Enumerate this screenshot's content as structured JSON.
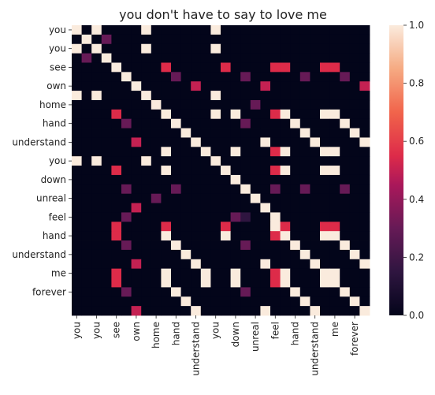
{
  "chart_data": {
    "type": "heatmap",
    "title": "you don't have to say to love me",
    "xlabel": "",
    "ylabel": "",
    "row_tick_labels": [
      "you",
      "you",
      "see",
      "own",
      "home",
      "hand",
      "understand",
      "you",
      "down",
      "unreal",
      "feel",
      "hand",
      "understand",
      "me",
      "forever"
    ],
    "col_tick_labels": [
      "you",
      "you",
      "see",
      "own",
      "home",
      "hand",
      "understand",
      "you",
      "down",
      "unreal",
      "feel",
      "hand",
      "understand",
      "me",
      "forever"
    ],
    "colorbar": {
      "min": 0.0,
      "max": 1.0,
      "ticks": [
        "0.0",
        "0.2",
        "0.4",
        "0.6",
        "0.8",
        "1.0"
      ]
    },
    "grid": false,
    "values": [
      [
        1,
        0,
        1,
        0,
        0,
        0,
        0,
        1,
        0,
        0,
        0,
        0,
        0,
        0,
        1,
        0,
        0,
        0,
        0,
        0,
        0,
        0,
        0,
        0,
        0,
        0,
        0,
        0,
        0,
        0
      ],
      [
        0,
        1,
        0,
        0.3,
        0,
        0,
        0,
        0,
        0,
        0,
        0,
        0,
        0,
        0,
        0,
        0,
        0,
        0,
        0,
        0,
        0,
        0,
        0,
        0,
        0,
        0,
        0,
        0,
        0,
        0
      ],
      [
        1,
        0,
        1,
        0,
        0,
        0,
        0,
        1,
        0,
        0,
        0,
        0,
        0,
        0,
        1,
        0,
        0,
        0,
        0,
        0,
        0,
        0,
        0,
        0,
        0,
        0,
        0,
        0,
        0,
        0
      ],
      [
        0,
        0.3,
        0,
        1,
        0,
        0,
        0,
        0,
        0,
        0,
        0,
        0,
        0,
        0,
        0,
        0,
        0,
        0,
        0,
        0,
        0,
        0,
        0,
        0,
        0,
        0,
        0,
        0,
        0,
        0
      ],
      [
        0,
        0,
        0,
        0,
        1,
        0,
        0,
        0,
        0,
        0.55,
        0,
        0,
        0,
        0,
        0,
        0.55,
        0,
        0,
        0,
        0,
        0.55,
        0.55,
        0,
        0,
        0,
        0.55,
        0.55,
        0,
        0,
        0
      ],
      [
        0,
        0,
        0,
        0,
        0,
        1,
        0,
        0,
        0,
        0,
        0.3,
        0,
        0,
        0,
        0,
        0,
        0,
        0.3,
        0,
        0,
        0,
        0,
        0,
        0.3,
        0,
        0,
        0,
        0.3,
        0,
        0
      ],
      [
        0,
        0,
        0,
        0,
        0,
        0,
        1,
        0,
        0,
        0,
        0,
        0,
        0.5,
        0,
        0,
        0,
        0,
        0,
        0,
        0.5,
        0,
        0,
        0,
        0,
        0,
        0,
        0,
        0,
        0,
        0.5
      ],
      [
        1,
        0,
        1,
        0,
        0,
        0,
        0,
        1,
        0,
        0,
        0,
        0,
        0,
        0,
        1,
        0,
        0,
        0,
        0,
        0,
        0,
        0,
        0,
        0,
        0,
        0,
        0,
        0,
        0,
        0
      ],
      [
        0,
        0,
        0,
        0,
        0,
        0,
        0,
        0,
        1,
        0,
        0,
        0,
        0,
        0,
        0,
        0,
        0,
        0,
        0.3,
        0,
        0,
        0,
        0,
        0,
        0,
        0,
        0,
        0,
        0,
        0
      ],
      [
        0,
        0,
        0,
        0,
        0.55,
        0,
        0,
        0,
        0,
        1,
        0,
        0,
        0,
        0,
        1,
        0,
        1,
        0,
        0,
        0,
        0.55,
        1,
        0,
        0,
        0,
        1,
        1,
        0,
        0,
        0
      ],
      [
        0,
        0,
        0,
        0,
        0,
        0.3,
        0,
        0,
        0,
        0,
        1,
        0,
        0,
        0,
        0,
        0,
        0,
        0.3,
        0,
        0,
        0,
        0,
        1,
        0,
        0,
        0,
        0,
        1,
        0,
        0
      ],
      [
        0,
        0,
        0,
        0,
        0,
        0,
        0,
        0,
        0,
        0,
        0,
        1,
        0,
        0,
        0,
        0,
        0,
        0,
        0,
        0,
        0,
        0,
        0,
        1,
        0,
        0,
        0,
        0,
        1,
        0
      ],
      [
        0,
        0,
        0,
        0,
        0,
        0,
        0.5,
        0,
        0,
        0,
        0,
        0,
        1,
        0,
        0,
        0,
        0,
        0,
        0,
        1,
        0,
        0,
        0,
        0,
        1,
        0,
        0,
        0,
        0,
        1
      ],
      [
        0,
        0,
        0,
        0,
        0,
        0,
        0,
        0,
        0,
        1,
        0,
        0,
        0,
        1,
        0,
        0,
        1,
        0,
        0,
        0,
        0.55,
        1,
        0,
        0,
        0,
        1,
        1,
        0,
        0,
        0
      ],
      [
        1,
        0,
        1,
        0,
        0,
        0,
        0,
        1,
        0,
        0,
        0,
        0,
        0,
        0,
        1,
        0,
        0,
        0,
        0,
        0,
        0,
        0,
        0,
        0,
        0,
        0,
        0,
        0,
        0,
        0
      ],
      [
        0,
        0,
        0,
        0,
        0.55,
        0,
        0,
        0,
        0,
        1,
        0,
        0,
        0,
        0,
        0,
        1,
        0,
        0,
        0,
        0,
        0.55,
        1,
        0,
        0,
        0,
        1,
        1,
        0,
        0,
        0
      ],
      [
        0,
        0,
        0,
        0,
        0,
        0,
        0,
        0,
        0,
        0,
        0,
        0,
        0,
        0,
        0,
        0,
        1,
        0,
        0,
        0,
        0,
        0,
        0,
        0,
        0,
        0,
        0,
        0,
        0,
        0
      ],
      [
        0,
        0,
        0,
        0,
        0,
        0.3,
        0,
        0,
        0,
        0,
        0.3,
        0,
        0,
        0,
        0,
        0,
        0,
        1,
        0,
        0,
        0.3,
        0,
        0,
        0.3,
        0,
        0,
        0,
        0.3,
        0,
        0
      ],
      [
        0,
        0,
        0,
        0,
        0,
        0,
        0,
        0,
        0.3,
        0,
        0,
        0,
        0,
        0,
        0,
        0,
        0,
        0,
        1,
        0,
        0,
        0,
        0,
        0,
        0,
        0,
        0,
        0,
        0,
        0
      ],
      [
        0,
        0,
        0,
        0,
        0,
        0,
        0.5,
        0,
        0,
        0,
        0,
        0,
        0,
        0,
        0,
        0,
        0,
        0,
        0,
        1,
        0,
        0,
        0,
        0,
        0,
        0,
        0,
        0,
        0,
        0
      ],
      [
        0,
        0,
        0,
        0,
        0,
        0.3,
        0,
        0,
        0,
        0,
        0,
        0,
        0,
        0,
        0,
        0,
        0.3,
        0.15,
        0,
        0,
        1,
        0,
        0,
        0,
        0,
        0,
        0,
        0,
        0,
        0
      ],
      [
        0,
        0,
        0,
        0,
        0.55,
        0,
        0,
        0,
        0,
        0.55,
        0,
        0,
        0,
        0,
        0,
        0.55,
        0,
        0,
        0,
        0,
        1,
        0.55,
        0,
        0,
        0,
        0.55,
        0.55,
        0,
        0,
        0
      ],
      [
        0,
        0,
        0,
        0,
        0.55,
        0,
        0,
        0,
        0,
        1,
        0,
        0,
        0,
        0,
        0,
        1,
        0,
        0,
        0,
        0,
        0.55,
        1,
        0,
        0,
        0,
        1,
        1,
        0,
        0,
        0
      ],
      [
        0,
        0,
        0,
        0,
        0,
        0.3,
        0,
        0,
        0,
        0,
        1,
        0,
        0,
        0,
        0,
        0,
        0,
        0.3,
        0,
        0,
        0,
        0,
        1,
        0,
        0,
        0,
        0,
        1,
        0,
        0
      ],
      [
        0,
        0,
        0,
        0,
        0,
        0,
        0,
        0,
        0,
        0,
        0,
        1,
        0,
        0,
        0,
        0,
        0,
        0,
        0,
        0,
        0,
        0,
        0,
        1,
        0,
        0,
        0,
        0,
        1,
        0
      ],
      [
        0,
        0,
        0,
        0,
        0,
        0,
        0.5,
        0,
        0,
        0,
        0,
        0,
        1,
        0,
        0,
        0,
        0,
        0,
        0,
        1,
        0,
        0,
        0,
        0,
        1,
        0,
        0,
        0,
        0,
        1
      ],
      [
        0,
        0,
        0,
        0,
        0.55,
        0,
        0,
        0,
        0,
        1,
        0,
        0,
        0,
        1,
        0,
        0,
        1,
        0,
        0,
        0,
        0.55,
        1,
        0,
        0,
        0,
        1,
        1,
        0,
        0,
        0
      ],
      [
        0,
        0,
        0,
        0,
        0.55,
        0,
        0,
        0,
        0,
        1,
        0,
        0,
        0,
        1,
        0,
        0,
        1,
        0,
        0,
        0,
        0.55,
        1,
        0,
        0,
        0,
        1,
        1,
        0,
        0,
        0
      ],
      [
        0,
        0,
        0,
        0,
        0,
        0.3,
        0,
        0,
        0,
        0,
        1,
        0,
        0,
        0,
        0,
        0,
        0,
        0.3,
        0,
        0,
        0,
        0,
        1,
        0,
        0,
        0,
        0,
        1,
        0,
        0
      ],
      [
        0,
        0,
        0,
        0,
        0,
        0,
        0,
        0,
        0,
        0,
        0,
        1,
        0,
        0,
        0,
        0,
        0,
        0,
        0,
        0,
        0,
        0,
        0,
        1,
        0,
        0,
        0,
        0,
        1,
        0
      ],
      [
        0,
        0,
        0,
        0,
        0,
        0,
        0.5,
        0,
        0,
        0,
        0,
        0,
        1,
        0,
        0,
        0,
        0,
        0,
        0,
        1,
        0,
        0,
        0,
        0,
        1,
        0,
        0,
        0,
        0,
        1
      ]
    ]
  }
}
